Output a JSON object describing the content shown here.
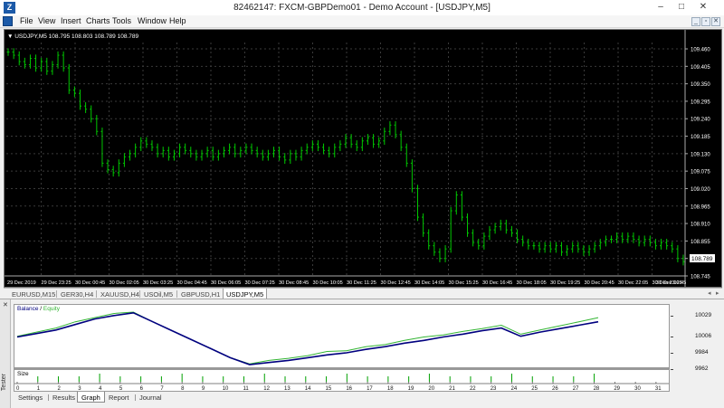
{
  "window": {
    "title": "82462147: FXCM-GBPDemo01 - Demo Account - [USDJPY,M5]",
    "app_icon": "Z",
    "minimize": "–",
    "maximize": "□",
    "close": "✕"
  },
  "menu": {
    "items": [
      "File",
      "View",
      "Insert",
      "Charts",
      "Tools",
      "Window",
      "Help"
    ],
    "child_buttons": [
      "_",
      "▫",
      "✕"
    ]
  },
  "chart": {
    "header": "▼ USDJPY,M5  108.795 108.803 108.789 108.789",
    "price_labels": [
      "109.460",
      "109.405",
      "109.350",
      "109.295",
      "109.240",
      "109.185",
      "109.130",
      "109.075",
      "109.020",
      "108.965",
      "108.910",
      "108.855",
      "108.800",
      "108.745"
    ],
    "current_price": "108.789",
    "time_labels": [
      "29 Dec 2019",
      "29 Dec 23:25",
      "30 Dec 00:45",
      "30 Dec 02:05",
      "30 Dec 03:25",
      "30 Dec 04:45",
      "30 Dec 06:05",
      "30 Dec 07:25",
      "30 Dec 08:45",
      "30 Dec 10:05",
      "30 Dec 11:25",
      "30 Dec 12:45",
      "30 Dec 14:05",
      "30 Dec 15:25",
      "30 Dec 16:45",
      "30 Dec 18:05",
      "30 Dec 19:25",
      "30 Dec 20:45",
      "30 Dec 22:05",
      "30 Dec 23:25",
      "31 Dec 00:45"
    ],
    "colors": {
      "background": "#000000",
      "bars": "#00c800",
      "grid": "#3a3a3a",
      "text": "#ffffff"
    }
  },
  "chart_data": {
    "type": "line",
    "title": "USDJPY,M5",
    "ylim": [
      108.745,
      109.48
    ],
    "values": [
      109.45,
      109.44,
      109.42,
      109.41,
      109.43,
      109.4,
      109.42,
      109.39,
      109.41,
      109.44,
      109.4,
      109.33,
      109.32,
      109.28,
      109.27,
      109.24,
      109.2,
      109.1,
      109.08,
      109.07,
      109.1,
      109.12,
      109.13,
      109.15,
      109.17,
      109.16,
      109.15,
      109.13,
      109.14,
      109.12,
      109.13,
      109.15,
      109.14,
      109.13,
      109.12,
      109.13,
      109.14,
      109.12,
      109.13,
      109.14,
      109.15,
      109.13,
      109.14,
      109.15,
      109.14,
      109.13,
      109.12,
      109.13,
      109.14,
      109.12,
      109.11,
      109.13,
      109.12,
      109.14,
      109.15,
      109.16,
      109.15,
      109.14,
      109.13,
      109.15,
      109.16,
      109.18,
      109.16,
      109.15,
      109.17,
      109.18,
      109.16,
      109.17,
      109.2,
      109.22,
      109.19,
      109.15,
      109.1,
      109.02,
      108.93,
      108.88,
      108.84,
      108.82,
      108.8,
      108.83,
      108.95,
      109.0,
      108.93,
      108.88,
      108.85,
      108.84,
      108.87,
      108.89,
      108.9,
      108.91,
      108.89,
      108.88,
      108.86,
      108.85,
      108.84,
      108.84,
      108.83,
      108.84,
      108.83,
      108.84,
      108.82,
      108.83,
      108.84,
      108.83,
      108.82,
      108.83,
      108.84,
      108.85,
      108.86,
      108.86,
      108.87,
      108.86,
      108.87,
      108.86,
      108.85,
      108.86,
      108.85,
      108.84,
      108.85,
      108.84,
      108.83,
      108.8,
      108.79
    ]
  },
  "symbol_tabs": {
    "items": [
      "EURUSD,M15",
      "GER30,H4",
      "XAUUSD,H4",
      "USOil,M5",
      "GBPUSD,H1",
      "USDJPY,M5"
    ],
    "active_index": 5,
    "left_arrow": "◂",
    "right_arrow": "▸"
  },
  "tester": {
    "side_label": "Tester",
    "close": "✕",
    "legend_balance": "Balance",
    "legend_sep": " / ",
    "legend_equity": "Equity",
    "size_label": "Size",
    "right_axis": [
      "10029",
      "10006",
      "9984",
      "9962"
    ],
    "x_labels": [
      "0",
      "1",
      "2",
      "3",
      "4",
      "5",
      "6",
      "7",
      "8",
      "9",
      "10",
      "11",
      "12",
      "13",
      "14",
      "15",
      "16",
      "17",
      "18",
      "19",
      "20",
      "21",
      "22",
      "23",
      "24",
      "25",
      "26",
      "27",
      "28",
      "29",
      "30",
      "31"
    ],
    "colors": {
      "balance": "#00007f",
      "equity": "#33b533",
      "size": "#00a000"
    },
    "balance_values": [
      9996,
      10001,
      10006,
      10014,
      10022,
      10027,
      10031,
      10018,
      10005,
      9992,
      9979,
      9966,
      9956,
      9959,
      9962,
      9966,
      9970,
      9973,
      9978,
      9982,
      9987,
      9991,
      9996,
      10000,
      10005,
      10009,
      9997,
      10003,
      10008,
      10013,
      10018
    ],
    "equity_values": [
      9997,
      10003,
      10009,
      10018,
      10024,
      10030,
      10032,
      10018,
      10005,
      9992,
      9979,
      9966,
      9957,
      9962,
      9965,
      9969,
      9975,
      9976,
      9982,
      9985,
      9991,
      9996,
      9999,
      10004,
      10008,
      10013,
      10000,
      10006,
      10012,
      10018,
      10024
    ],
    "size_markers": [
      1,
      2,
      3,
      4,
      5,
      6,
      7,
      8,
      9,
      10,
      11,
      12,
      13,
      14,
      15,
      16,
      17,
      18,
      19,
      20,
      21,
      22,
      23,
      24,
      25,
      26,
      27,
      28,
      29,
      30,
      31
    ],
    "bottom_tabs": [
      "Settings",
      "Results",
      "Graph",
      "Report",
      "Journal"
    ],
    "active_tab_index": 2
  }
}
